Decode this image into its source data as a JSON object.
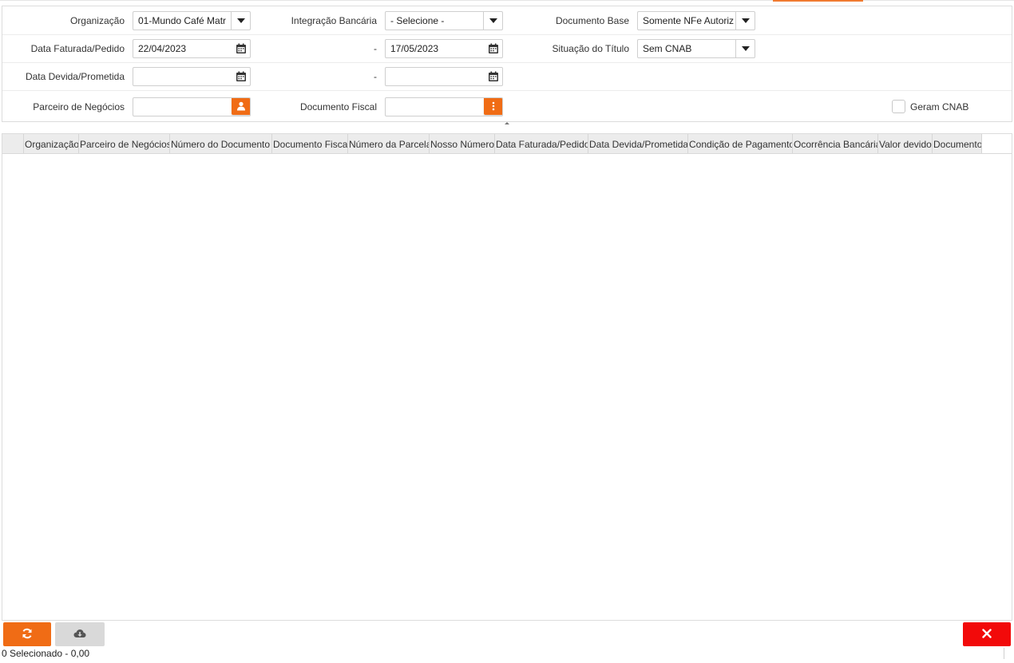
{
  "filters": {
    "organizacao": {
      "label": "Organização",
      "value": "01-Mundo Café Matr"
    },
    "integracao_bancaria": {
      "label": "Integração Bancária",
      "value": "- Selecione -"
    },
    "documento_base": {
      "label": "Documento Base",
      "value": "Somente NFe Autoriz"
    },
    "data_faturada": {
      "label": "Data Faturada/Pedido",
      "from": "22/04/2023",
      "sep": "-",
      "to": "17/05/2023"
    },
    "situacao_titulo": {
      "label": "Situação do Título",
      "value": "Sem CNAB"
    },
    "data_devida": {
      "label": "Data Devida/Prometida",
      "from": "",
      "sep": "-",
      "to": ""
    },
    "parceiro": {
      "label": "Parceiro de Negócios",
      "value": ""
    },
    "documento_fiscal": {
      "label": "Documento Fiscal",
      "value": ""
    },
    "geram_cnab": {
      "label": "Geram CNAB",
      "checked": false
    }
  },
  "grid": {
    "columns": [
      "Organização",
      "Parceiro de Negócios",
      "Número do Documento",
      "Documento Fiscal",
      "Número da Parcela",
      "Nosso Número",
      "Data Faturada/Pedido",
      "Data Devida/Prometida",
      "Condição de Pagamento",
      "Ocorrência Bancária",
      "Valor devido",
      "Documento"
    ],
    "rows": []
  },
  "footer": {
    "status": "0 Selecionado - 0,00"
  },
  "colors": {
    "accent": "#f06c15",
    "close": "#f20a0a",
    "header_bg": "#ececec"
  },
  "icons": {
    "calendar": "calendar-icon",
    "dropdown": "chevron-down-icon",
    "partner": "user-icon",
    "fiscal": "more-vertical-icon",
    "refresh": "refresh-icon",
    "download": "cloud-download-icon",
    "close": "close-icon"
  }
}
